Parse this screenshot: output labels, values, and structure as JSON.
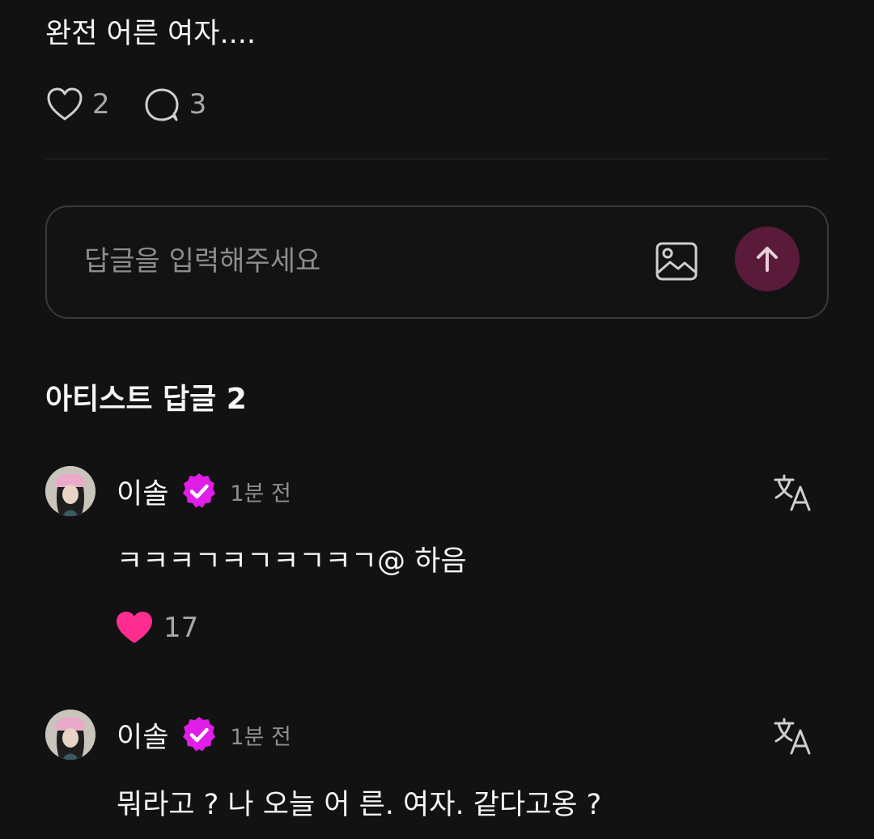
{
  "post": {
    "text": "완전 어른 여자....",
    "like_count": "2",
    "comment_count": "3"
  },
  "reply_input": {
    "placeholder": "답글을 입력해주세요"
  },
  "section": {
    "title": "아티스트 답글 2"
  },
  "comments": [
    {
      "author": "이솔",
      "time": "1분 전",
      "text": "ㅋㅋㅋㄱㅋㄱㅋㄱㅋㄱ@ 하음",
      "like_count": "17",
      "liked": true
    },
    {
      "author": "이솔",
      "time": "1분 전",
      "text": "뭐라고 ? 나 오늘 어 른. 여자. 같다고옹 ?"
    }
  ],
  "icons": {
    "post_like": "heart-outline-icon",
    "post_comment": "speech-bubble-icon",
    "image": "image-icon",
    "send": "arrow-up-icon",
    "verified": "verified-badge-icon",
    "translate": "translate-icon",
    "comment_like": "heart-filled-icon"
  },
  "colors": {
    "background": "#121212",
    "accent_pink": "#ff2d8f",
    "verified_purple": "#e01ee8",
    "send_button": "#5a1a3a"
  }
}
